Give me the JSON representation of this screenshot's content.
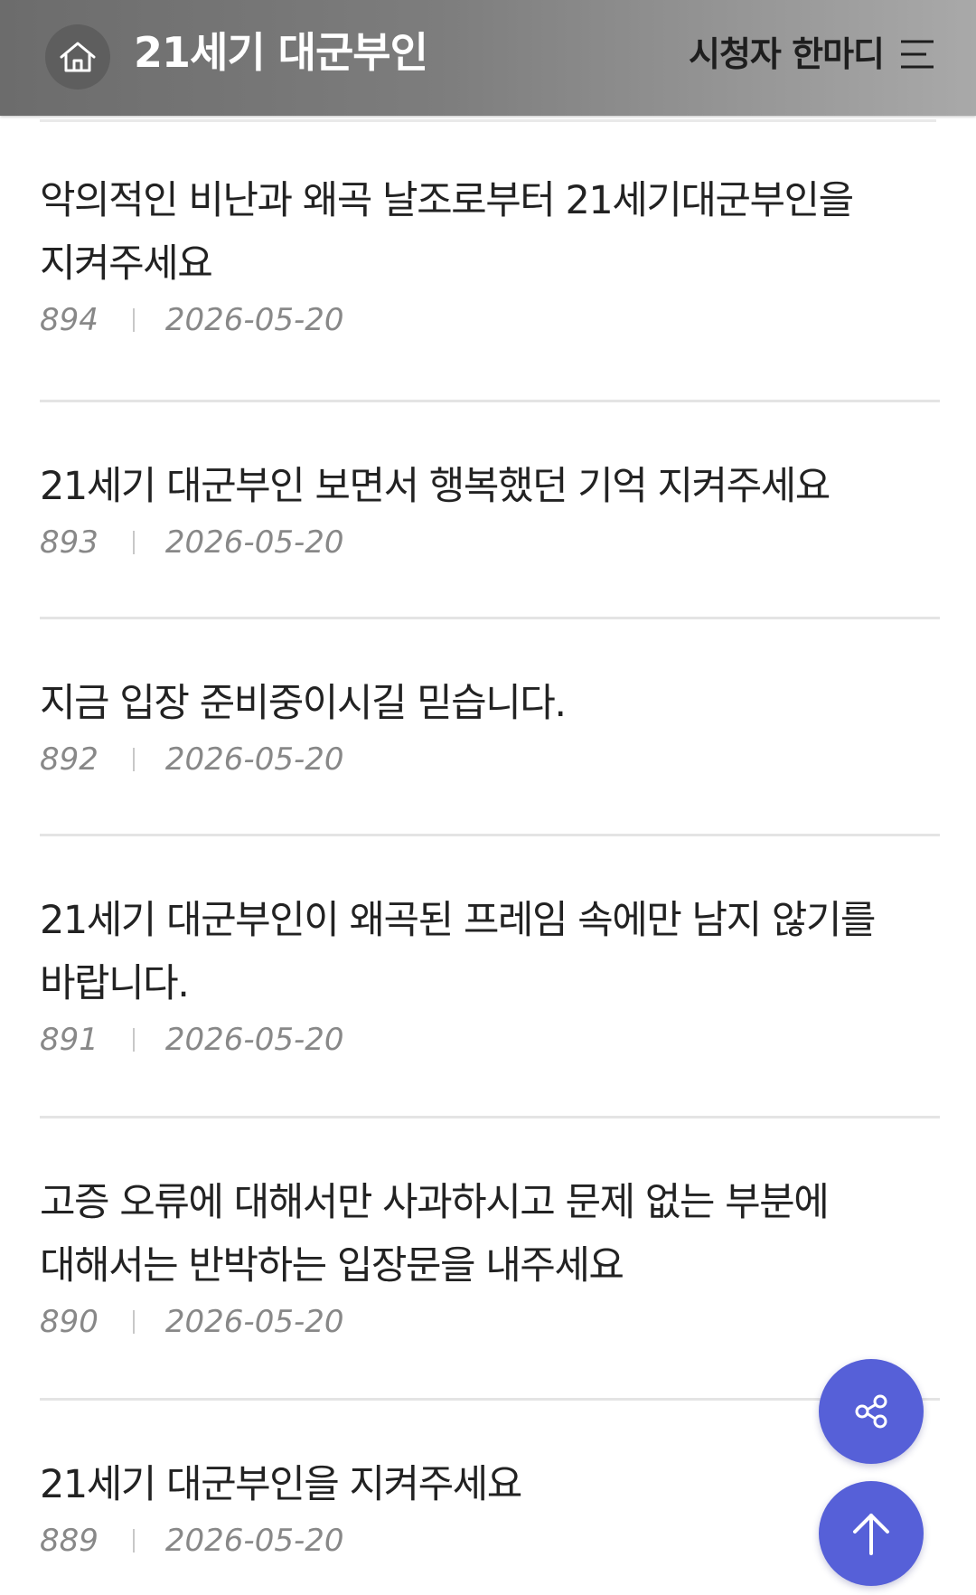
{
  "header": {
    "title": "21세기 대군부인",
    "viewer_link": "시청자 한마디",
    "home_icon": "home-icon",
    "menu_icon": "hamburger-menu-icon"
  },
  "posts": [
    {
      "title": "악의적인 비난과 왜곡 날조로부터 21세기대군부인을 지켜주세요",
      "number": "894",
      "date": "2026-05-20"
    },
    {
      "title": "21세기 대군부인 보면서 행복했던 기억 지켜주세요",
      "number": "893",
      "date": "2026-05-20"
    },
    {
      "title": "지금 입장 준비중이시길 믿습니다.",
      "number": "892",
      "date": "2026-05-20"
    },
    {
      "title": "21세기 대군부인이 왜곡된 프레임 속에만 남지 않기를 바랍니다.",
      "number": "891",
      "date": "2026-05-20"
    },
    {
      "title": "고증 오류에 대해서만 사과하시고 문제 없는 부분에 대해서는 반박하는 입장문을 내주세요",
      "number": "890",
      "date": "2026-05-20"
    },
    {
      "title": "21세기 대군부인을 지켜주세요",
      "number": "889",
      "date": "2026-05-20"
    }
  ],
  "fab": {
    "share_icon": "share-icon",
    "top_icon": "arrow-up-icon",
    "accent_color": "#5660d8"
  }
}
